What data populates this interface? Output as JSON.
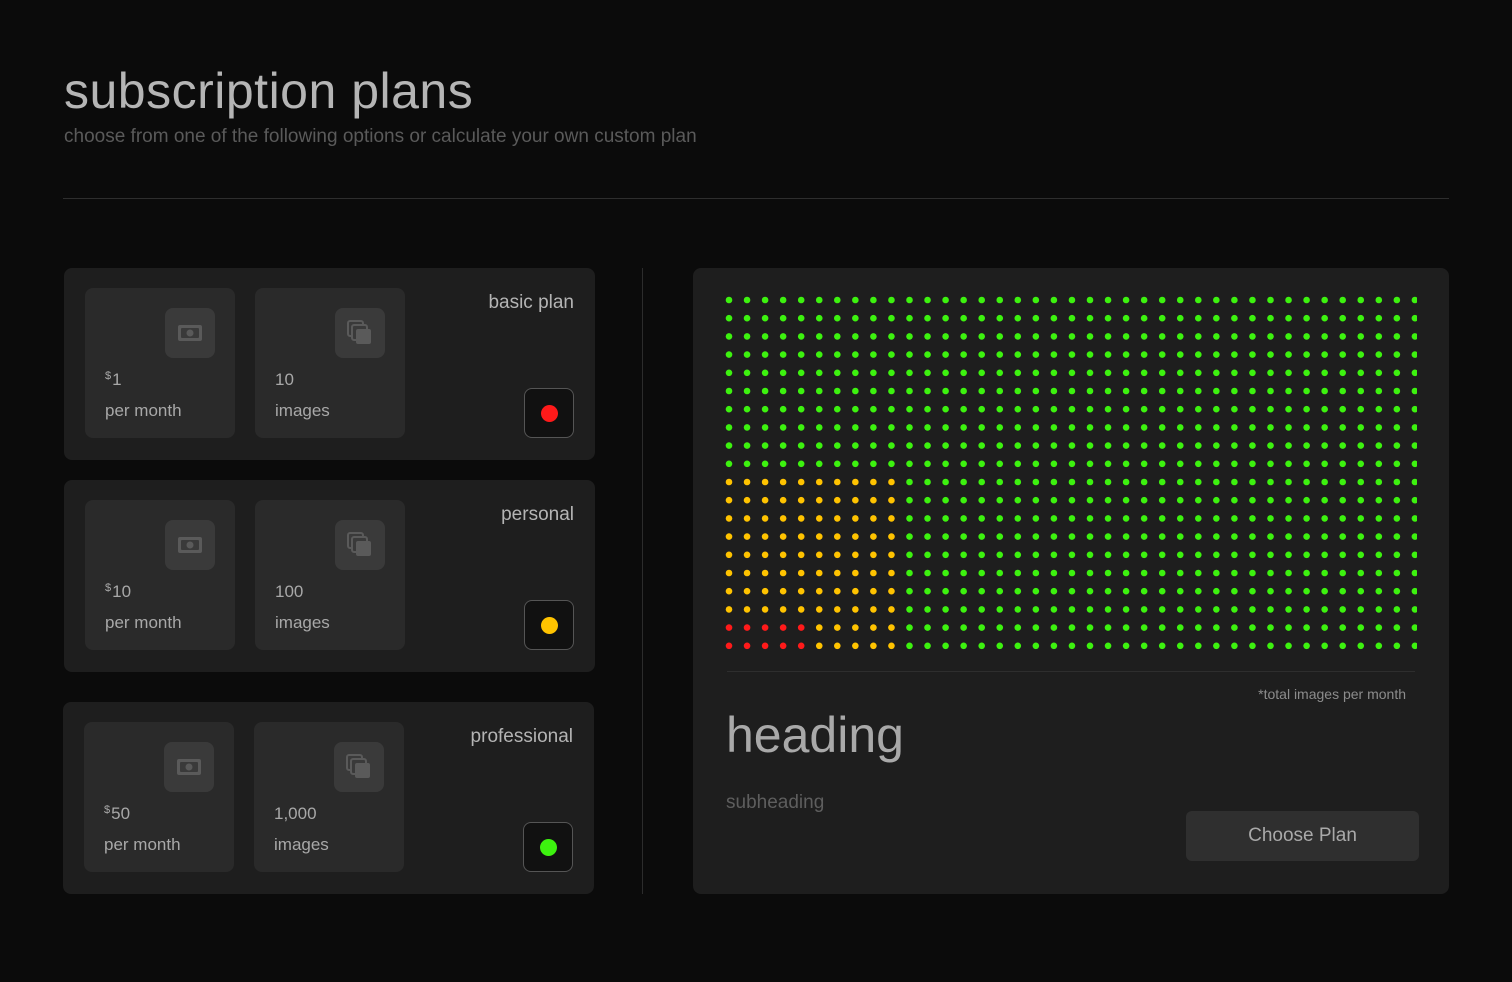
{
  "header": {
    "title": "subscription plans",
    "subtitle": "choose from one of the following options or calculate your own custom plan"
  },
  "plans": [
    {
      "name": "basic plan",
      "price_symbol": "$",
      "price": "1",
      "price_unit": "per month",
      "images": "10",
      "images_unit": "images",
      "color": "#ff1a1a"
    },
    {
      "name": "personal",
      "price_symbol": "$",
      "price": "10",
      "price_unit": "per month",
      "images": "100",
      "images_unit": "images",
      "color": "#ffc300"
    },
    {
      "name": "professional",
      "price_symbol": "$",
      "price": "50",
      "price_unit": "per month",
      "images": "1,000",
      "images_unit": "images",
      "color": "#3df20f"
    }
  ],
  "icons": {
    "price": "money-icon",
    "images": "images-stack-icon"
  },
  "preview": {
    "note": "*total images per month",
    "heading": "heading",
    "subheading": "subheading",
    "button_label": "Choose Plan",
    "dot_grid": {
      "columns": 39,
      "rows": 20,
      "total_dots": 780,
      "colors": {
        "basic": "#ff1a1a",
        "personal": "#ffc300",
        "professional": "#3df20f"
      }
    }
  }
}
